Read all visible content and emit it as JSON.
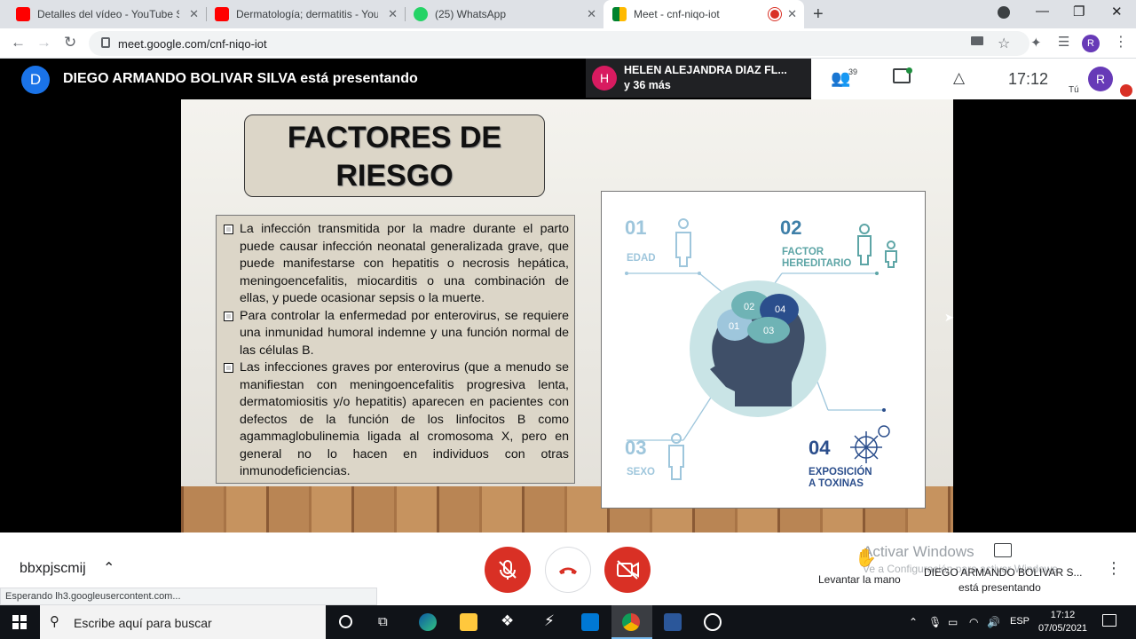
{
  "browser": {
    "tabs": [
      {
        "title": "Detalles del vídeo - YouTube Studio",
        "color": "#ff0000"
      },
      {
        "title": "Dermatología; dermatitis - YouTube",
        "color": "#ff0000"
      },
      {
        "title": "(25) WhatsApp",
        "color": "#25d366"
      },
      {
        "title": "Meet - cnf-niqo-iot",
        "color": "#00832d"
      }
    ],
    "url": "meet.google.com/cnf-niqo-iot",
    "profile_initial": "R"
  },
  "meet": {
    "presenter_initial": "D",
    "presenting_text": "DIEGO ARMANDO BOLIVAR SILVA está presentando",
    "speaker_initial": "H",
    "speaker_name": "HELEN ALEJANDRA DIAZ FL...",
    "speaker_more": "y 36 más",
    "participants_count": "39",
    "time": "17:12",
    "you_label": "Tú",
    "user_initial": "R",
    "meeting_code": "bbxpjscmij",
    "raise_hand_label": "Levantar la mano",
    "presenting_short": "DIEGO ARMANDO BOLIVAR S...",
    "presenting_short2": "está presentando",
    "activate_windows": "Activar Windows",
    "activate_windows_sub": "Ve a Configuración para activar Windows.",
    "status_text": "Esperando lh3.googleusercontent.com..."
  },
  "slide": {
    "title_line1": "FACTORES DE",
    "title_line2": "RIESGO",
    "bullets": [
      "La infección transmitida por la madre durante el parto puede causar infección neonatal generalizada grave, que puede manifestarse con hepatitis o necrosis hepática, meningoencefalitis, miocarditis o una combinación de ellas, y puede ocasionar sepsis o la muerte.",
      "Para controlar la enfermedad por enterovirus, se requiere una inmunidad humoral indemne y una función normal de las células B.",
      "Las infecciones graves por enterovirus (que a menudo se manifiestan con meningoencefalitis progresiva lenta, dermatomiositis y/o hepatitis) aparecen en pacientes con defectos de la función de los linfocitos B como agammaglobulinemia ligada al cromosoma X, pero en general no lo hacen en individuos con otras inmunodeficiencias."
    ],
    "infographic": {
      "items": [
        {
          "num": "01",
          "label": "EDAD"
        },
        {
          "num": "02",
          "label1": "FACTOR",
          "label2": "HEREDITARIO"
        },
        {
          "num": "03",
          "label": "SEXO"
        },
        {
          "num": "04",
          "label1": "EXPOSICIÓN",
          "label2": "A TOXINAS"
        }
      ],
      "brain_labels": [
        "01",
        "02",
        "03",
        "04"
      ]
    }
  },
  "taskbar": {
    "search_placeholder": "Escribe aquí para buscar",
    "language": "ESP",
    "time": "17:12",
    "date": "07/05/2021"
  }
}
